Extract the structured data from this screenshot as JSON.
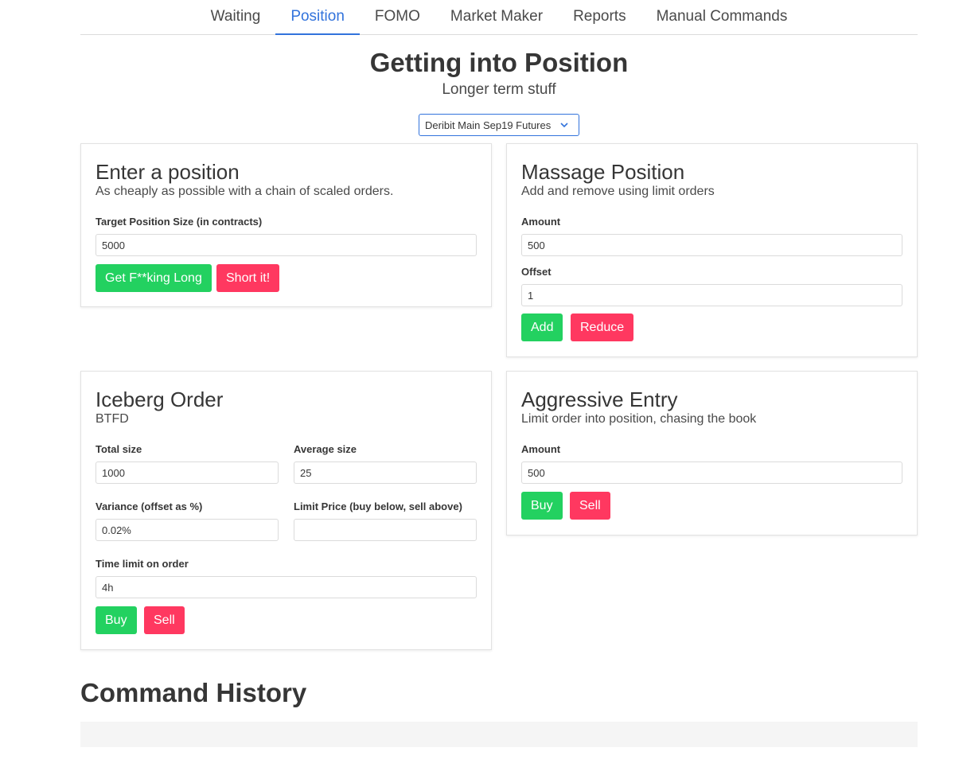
{
  "nav": {
    "tabs": [
      {
        "label": "Waiting"
      },
      {
        "label": "Position"
      },
      {
        "label": "FOMO"
      },
      {
        "label": "Market Maker"
      },
      {
        "label": "Reports"
      },
      {
        "label": "Manual Commands"
      }
    ],
    "active_tab": "Position"
  },
  "hero": {
    "title": "Getting into Position",
    "subtitle": "Longer term stuff"
  },
  "account_select": {
    "value": "Deribit Main Sep19 Futures"
  },
  "enter_position": {
    "title": "Enter a position",
    "subtitle": "As cheaply as possible with a chain of scaled orders.",
    "target_label": "Target Position Size (in contracts)",
    "target_value": "5000",
    "long_button": "Get F**king Long",
    "short_button": "Short it!"
  },
  "massage_position": {
    "title": "Massage Position",
    "subtitle": "Add and remove using limit orders",
    "amount_label": "Amount",
    "amount_value": "500",
    "offset_label": "Offset",
    "offset_value": "1",
    "add_button": "Add",
    "reduce_button": "Reduce"
  },
  "iceberg": {
    "title": "Iceberg Order",
    "subtitle": "BTFD",
    "total_label": "Total size",
    "total_value": "1000",
    "average_label": "Average size",
    "average_value": "25",
    "variance_label": "Variance (offset as %)",
    "variance_value": "0.02%",
    "limit_label": "Limit Price (buy below, sell above)",
    "limit_value": "",
    "time_label": "Time limit on order",
    "time_value": "4h",
    "buy_button": "Buy",
    "sell_button": "Sell"
  },
  "aggressive": {
    "title": "Aggressive Entry",
    "subtitle": "Limit order into position, chasing the book",
    "amount_label": "Amount",
    "amount_value": "500",
    "buy_button": "Buy",
    "sell_button": "Sell"
  },
  "history": {
    "title": "Command History"
  },
  "colors": {
    "primary": "#3273dc",
    "success": "#23d160",
    "danger": "#ff3860",
    "text": "#363636"
  }
}
